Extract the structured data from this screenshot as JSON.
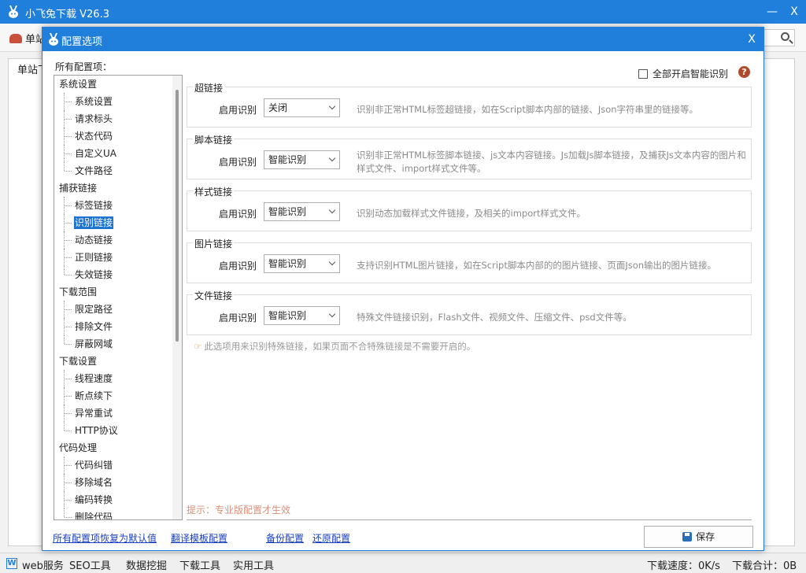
{
  "main_window": {
    "title": "小飞兔下载 V26.3",
    "minimize_glyph": "—",
    "close_glyph": "X",
    "toolbar_first_label": "单站",
    "panel_label": "单站下",
    "status_items": [
      "web服务",
      "SEO工具",
      "数据挖掘",
      "下载工具",
      "实用工具"
    ],
    "status_speed": "下载速度：0K/s",
    "status_total": "下载合计：0B"
  },
  "dialog": {
    "title": "配置选项",
    "close_glyph": "X",
    "tree_label": "所有配置项：",
    "tree": [
      {
        "category": "系统设置",
        "items": [
          "系统设置",
          "请求标头",
          "状态代码",
          "自定义UA",
          "文件路径"
        ]
      },
      {
        "category": "捕获链接",
        "items": [
          "标签链接",
          "识别链接",
          "动态链接",
          "正则链接",
          "失效链接"
        ]
      },
      {
        "category": "下载范围",
        "items": [
          "限定路径",
          "排除文件",
          "屏蔽网域"
        ]
      },
      {
        "category": "下载设置",
        "items": [
          "线程速度",
          "断点续下",
          "异常重试",
          "HTTP协议"
        ]
      },
      {
        "category": "代码处理",
        "items": [
          "代码纠错",
          "移除域名",
          "编码转换",
          "删除代码"
        ]
      }
    ],
    "selected_item": "识别链接",
    "smart_all_label": "全部开启智能识别",
    "smart_all_checked": false,
    "help_glyph": "?",
    "groups": [
      {
        "title": "超链接",
        "label": "启用识别",
        "value": "关闭",
        "desc": "识别非正常HTML标签超链接，如在Script脚本内部的链接、Json字符串里的链接等。"
      },
      {
        "title": "脚本链接",
        "label": "启用识别",
        "value": "智能识别",
        "desc": "识别非正常HTML标签脚本链接、js文本内容链接。Js加载Js脚本链接，及捕获Js文本内容的图片和样式文件、import样式文件等。"
      },
      {
        "title": "样式链接",
        "label": "启用识别",
        "value": "智能识别",
        "desc": "识别动态加载样式文件链接，及相关的import样式文件。"
      },
      {
        "title": "图片链接",
        "label": "启用识别",
        "value": "智能识别",
        "desc": "支持识别HTML图片链接，如在Script脚本内部的的图片链接、页面Json输出的图片链接。"
      },
      {
        "title": "文件链接",
        "label": "启用识别",
        "value": "智能识别",
        "desc": "特殊文件链接识别，Flash文件、视频文件、压缩文件、psd文件等。"
      }
    ],
    "tip_text": "此选项用来识别特殊链接，如果页面不合特殊链接是不需要开启的。",
    "pro_note": "提示：专业版配置才生效",
    "links": {
      "restore_defaults": "所有配置项恢复为默认值",
      "translate_template": "翻译模板配置",
      "backup": "备份配置",
      "restore": "还原配置"
    },
    "save_label": "保存"
  },
  "colors": {
    "titlebar": "#1f7fdb",
    "selection": "#1c73d2",
    "link": "#1a3fbf",
    "pro_note": "#d7907a",
    "help_icon": "#b04a2b"
  }
}
